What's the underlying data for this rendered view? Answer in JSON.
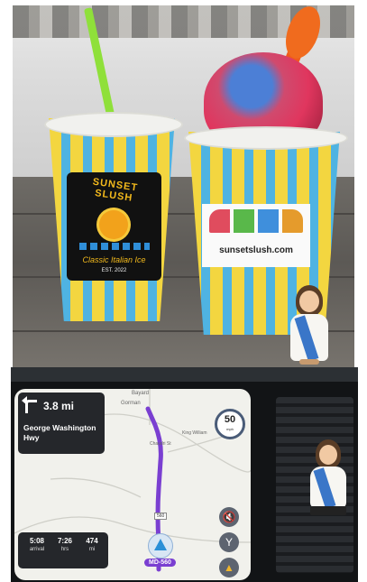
{
  "top_photo": {
    "cup_left": {
      "brand": "SUNSET SLUSH",
      "subtitle": "Classic Italian Ice",
      "est": "EST. 2022"
    },
    "cup_right": {
      "url": "sunsetslush.com"
    },
    "colors": {
      "stripe_yellow": "#f3d640",
      "stripe_blue": "#4fb3e2",
      "straw": "#8fe03a",
      "spoon": "#f05a1c"
    }
  },
  "navigation": {
    "maneuver_icon": "turn-left-arrow-icon",
    "distance": "3.8 mi",
    "street": "George Washington Hwy",
    "speed_limit": "50",
    "speed_unit": "mph",
    "route_shield": "MD-560",
    "route_shield_small": "560",
    "places": [
      "Gorman",
      "Bayard",
      "King William",
      "Chaudri St"
    ],
    "eta": {
      "arrival_time": "5:08",
      "arrival_label": "arrival",
      "duration": "7:26",
      "duration_label": "hrs",
      "distance": "474",
      "distance_label": "mi"
    }
  }
}
